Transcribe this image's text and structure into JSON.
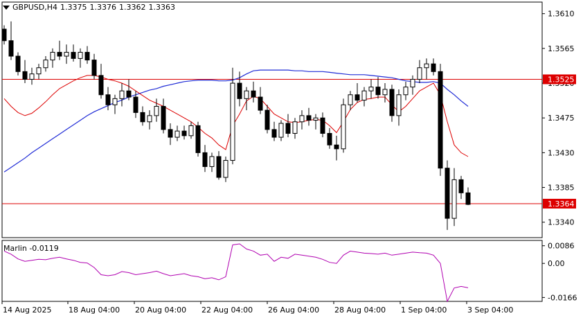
{
  "header": {
    "symbol": "GBPUSD,H4",
    "open": "1.3375",
    "high": "1.3376",
    "low": "1.3362",
    "close": "1.3363"
  },
  "colors": {
    "bull_fill": "#ffffff",
    "bear_fill": "#000000",
    "candle_stroke": "#000000",
    "ma_fast": "#dd0000",
    "ma_slow": "#1f2bd6",
    "hline": "#dd0000",
    "hline_label_bg": "#dd0000",
    "hline_label_text": "#ffffff",
    "oscillator": "#b000b0",
    "axis": "#000000"
  },
  "chart_data": [
    {
      "type": "candlestick",
      "title": "GBPUSD,H4",
      "x_tick_labels": [
        "14 Aug 2025",
        "18 Aug 04:00",
        "20 Aug 04:00",
        "22 Aug 04:00",
        "26 Aug 04:00",
        "28 Aug 04:00",
        "1 Sep 04:00",
        "3 Sep 04:00"
      ],
      "y_tick_labels": [
        "1.3610",
        "1.3565",
        "1.3520",
        "1.3475",
        "1.3430",
        "1.3385",
        "1.3340"
      ],
      "ylim": [
        1.332,
        1.3625
      ],
      "grid": false,
      "horizontal_lines": [
        {
          "value": 1.3525,
          "label": "1.3525"
        },
        {
          "value": 1.3364,
          "label": "1.3364"
        }
      ],
      "ohlc": [
        [
          1.359,
          1.3595,
          1.357,
          1.3575
        ],
        [
          1.3575,
          1.36,
          1.355,
          1.3555
        ],
        [
          1.3555,
          1.356,
          1.353,
          1.3535
        ],
        [
          1.3535,
          1.355,
          1.352,
          1.3525
        ],
        [
          1.3525,
          1.354,
          1.3518,
          1.3532
        ],
        [
          1.3532,
          1.3545,
          1.3525,
          1.354
        ],
        [
          1.354,
          1.3555,
          1.3535,
          1.355
        ],
        [
          1.355,
          1.3565,
          1.354,
          1.356
        ],
        [
          1.356,
          1.3575,
          1.355,
          1.3555
        ],
        [
          1.3555,
          1.357,
          1.3545,
          1.356
        ],
        [
          1.356,
          1.357,
          1.3548,
          1.3552
        ],
        [
          1.3552,
          1.3565,
          1.354,
          1.356
        ],
        [
          1.356,
          1.3568,
          1.3545,
          1.355
        ],
        [
          1.355,
          1.3558,
          1.3525,
          1.353
        ],
        [
          1.353,
          1.3545,
          1.35,
          1.3505
        ],
        [
          1.3505,
          1.3515,
          1.3485,
          1.3492
        ],
        [
          1.3492,
          1.3505,
          1.348,
          1.35
        ],
        [
          1.35,
          1.352,
          1.349,
          1.351
        ],
        [
          1.351,
          1.3525,
          1.3498,
          1.3502
        ],
        [
          1.3502,
          1.351,
          1.3475,
          1.3482
        ],
        [
          1.3482,
          1.349,
          1.3465,
          1.347
        ],
        [
          1.347,
          1.3485,
          1.346,
          1.3478
        ],
        [
          1.3478,
          1.35,
          1.347,
          1.349
        ],
        [
          1.349,
          1.35,
          1.3455,
          1.346
        ],
        [
          1.346,
          1.3468,
          1.344,
          1.345
        ],
        [
          1.345,
          1.3465,
          1.3445,
          1.3458
        ],
        [
          1.3458,
          1.3465,
          1.3447,
          1.3452
        ],
        [
          1.3452,
          1.347,
          1.3448,
          1.3465
        ],
        [
          1.3465,
          1.347,
          1.3425,
          1.343
        ],
        [
          1.343,
          1.344,
          1.3405,
          1.3412
        ],
        [
          1.3412,
          1.343,
          1.3405,
          1.3425
        ],
        [
          1.3425,
          1.3432,
          1.3395,
          1.3398
        ],
        [
          1.3398,
          1.3425,
          1.3392,
          1.342
        ],
        [
          1.342,
          1.354,
          1.3415,
          1.352
        ],
        [
          1.352,
          1.3535,
          1.349,
          1.35
        ],
        [
          1.35,
          1.3515,
          1.3485,
          1.351
        ],
        [
          1.351,
          1.3522,
          1.3495,
          1.3502
        ],
        [
          1.3502,
          1.3515,
          1.348,
          1.3485
        ],
        [
          1.3485,
          1.3492,
          1.3455,
          1.346
        ],
        [
          1.346,
          1.347,
          1.3445,
          1.345
        ],
        [
          1.345,
          1.3472,
          1.3445,
          1.3468
        ],
        [
          1.3468,
          1.348,
          1.345,
          1.3455
        ],
        [
          1.3455,
          1.3475,
          1.3448,
          1.347
        ],
        [
          1.347,
          1.3485,
          1.346,
          1.3478
        ],
        [
          1.3478,
          1.3488,
          1.3465,
          1.3472
        ],
        [
          1.3472,
          1.348,
          1.346,
          1.3475
        ],
        [
          1.3475,
          1.3482,
          1.345,
          1.3455
        ],
        [
          1.3455,
          1.3462,
          1.3435,
          1.344
        ],
        [
          1.344,
          1.3452,
          1.342,
          1.3435
        ],
        [
          1.3435,
          1.35,
          1.343,
          1.3492
        ],
        [
          1.3492,
          1.351,
          1.3485,
          1.3505
        ],
        [
          1.3505,
          1.352,
          1.3495,
          1.3498
        ],
        [
          1.3498,
          1.3515,
          1.349,
          1.351
        ],
        [
          1.351,
          1.3525,
          1.35,
          1.3515
        ],
        [
          1.3515,
          1.3528,
          1.35,
          1.3505
        ],
        [
          1.3505,
          1.352,
          1.3495,
          1.3512
        ],
        [
          1.3512,
          1.3518,
          1.347,
          1.3478
        ],
        [
          1.3478,
          1.3512,
          1.3465,
          1.3505
        ],
        [
          1.3505,
          1.3522,
          1.3498,
          1.3515
        ],
        [
          1.3515,
          1.353,
          1.3505,
          1.3525
        ],
        [
          1.3525,
          1.355,
          1.352,
          1.354
        ],
        [
          1.354,
          1.3552,
          1.3525,
          1.3545
        ],
        [
          1.3545,
          1.3552,
          1.353,
          1.3535
        ],
        [
          1.3535,
          1.3545,
          1.34,
          1.341
        ],
        [
          1.341,
          1.342,
          1.333,
          1.3345
        ],
        [
          1.3345,
          1.341,
          1.3335,
          1.3395
        ],
        [
          1.3395,
          1.34,
          1.337,
          1.3378
        ],
        [
          1.3378,
          1.3385,
          1.3362,
          1.3363
        ]
      ],
      "ma_fast": [
        1.35,
        1.349,
        1.3482,
        1.3478,
        1.3481,
        1.3488,
        1.3496,
        1.3505,
        1.3513,
        1.3518,
        1.3523,
        1.3527,
        1.353,
        1.353,
        1.3528,
        1.3525,
        1.3523,
        1.352,
        1.3516,
        1.351,
        1.3504,
        1.3498,
        1.3494,
        1.349,
        1.3485,
        1.348,
        1.3475,
        1.347,
        1.3463,
        1.3455,
        1.3449,
        1.344,
        1.3434,
        1.3465,
        1.348,
        1.3497,
        1.3503,
        1.35,
        1.349,
        1.348,
        1.3475,
        1.347,
        1.3469,
        1.347,
        1.3472,
        1.3473,
        1.3472,
        1.3465,
        1.3456,
        1.347,
        1.3486,
        1.3495,
        1.3499,
        1.35,
        1.3502,
        1.3502,
        1.3492,
        1.3483,
        1.349,
        1.35,
        1.351,
        1.3515,
        1.352,
        1.3505,
        1.347,
        1.344,
        1.343,
        1.3425
      ],
      "ma_slow": [
        1.3405,
        1.3411,
        1.3417,
        1.3423,
        1.343,
        1.3436,
        1.3442,
        1.3448,
        1.3454,
        1.346,
        1.3466,
        1.3472,
        1.3478,
        1.3483,
        1.3487,
        1.3491,
        1.3495,
        1.3498,
        1.3502,
        1.3505,
        1.3508,
        1.3511,
        1.3513,
        1.3516,
        1.3518,
        1.352,
        1.3522,
        1.3523,
        1.3524,
        1.3524,
        1.3524,
        1.3523,
        1.3523,
        1.3524,
        1.3527,
        1.3532,
        1.3536,
        1.3537,
        1.3537,
        1.3537,
        1.3537,
        1.3537,
        1.3536,
        1.3536,
        1.3535,
        1.3535,
        1.3535,
        1.3534,
        1.3533,
        1.3532,
        1.3531,
        1.3531,
        1.3531,
        1.353,
        1.3529,
        1.3528,
        1.3527,
        1.3525,
        1.3523,
        1.3522,
        1.3521,
        1.3521,
        1.3522,
        1.352,
        1.3512,
        1.3505,
        1.3497,
        1.349
      ]
    },
    {
      "type": "line",
      "series_label": "Marlin -0.0119",
      "y_tick_labels": [
        "0.0086",
        "0.00",
        "-0.0166"
      ],
      "ylim": [
        -0.0185,
        0.0112
      ],
      "grid": false,
      "values": [
        0.006,
        0.0045,
        0.0022,
        0.001,
        0.0015,
        0.002,
        0.0018,
        0.0025,
        0.003,
        0.0022,
        0.0015,
        0.0005,
        0.0002,
        -0.002,
        -0.0055,
        -0.006,
        -0.0055,
        -0.004,
        -0.0045,
        -0.0055,
        -0.005,
        -0.0045,
        -0.0038,
        -0.005,
        -0.006,
        -0.0055,
        -0.005,
        -0.006,
        -0.0065,
        -0.0075,
        -0.007,
        -0.008,
        -0.0065,
        0.009,
        0.0095,
        0.007,
        0.006,
        0.004,
        0.0045,
        0.001,
        0.003,
        0.0025,
        0.0045,
        0.004,
        0.0035,
        0.003,
        0.002,
        0.0005,
        0.0,
        0.004,
        0.006,
        0.0055,
        0.005,
        0.0048,
        0.0045,
        0.005,
        0.004,
        0.0045,
        0.005,
        0.0055,
        0.0052,
        0.005,
        0.004,
        0.0,
        -0.0185,
        -0.012,
        -0.0112,
        -0.0119
      ]
    }
  ]
}
